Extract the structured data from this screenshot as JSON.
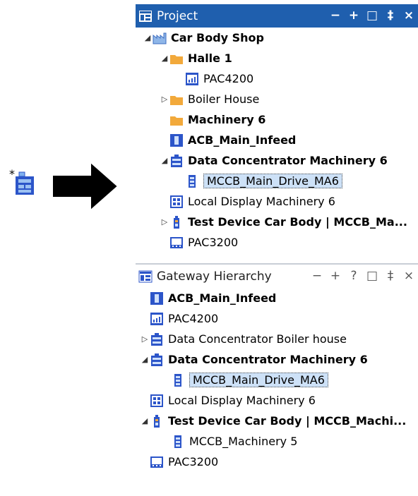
{
  "project": {
    "title": "Project",
    "controls": {
      "minimize": "−",
      "add": "+",
      "maximize": "□",
      "pin": "‡",
      "close": "×"
    },
    "items": [
      {
        "label": "Car Body Shop",
        "expander": "◢",
        "icon": "factory-icon"
      },
      {
        "label": "Halle 1",
        "expander": "◢",
        "icon": "folder-icon"
      },
      {
        "label": "PAC4200",
        "icon": "meter-icon"
      },
      {
        "label": "Boiler House",
        "expander": "▷",
        "icon": "folder-icon"
      },
      {
        "label": "Machinery 6",
        "icon": "folder-icon"
      },
      {
        "label": "ACB_Main_Infeed",
        "icon": "breaker-icon"
      },
      {
        "label": "Data Concentrator Machinery 6",
        "expander": "◢",
        "icon": "concentrator-icon"
      },
      {
        "label": "MCCB_Main_Drive_MA6",
        "icon": "mccb-icon",
        "selected": true
      },
      {
        "label": "Local Display Machinery 6",
        "icon": "display-icon"
      },
      {
        "label": "Test Device Car Body | MCCB_Ma...",
        "expander": "▷",
        "icon": "test-device-icon"
      },
      {
        "label": "PAC3200",
        "icon": "pac3200-icon"
      }
    ]
  },
  "gateway": {
    "title": "Gateway Hierarchy",
    "controls": {
      "minimize": "−",
      "add": "+",
      "help": "?",
      "maximize": "□",
      "pin": "‡",
      "close": "×"
    },
    "items": [
      {
        "label": "ACB_Main_Infeed",
        "icon": "breaker-icon"
      },
      {
        "label": "PAC4200",
        "icon": "meter-icon"
      },
      {
        "label": "Data Concentrator Boiler house",
        "expander": "▷",
        "icon": "concentrator-icon"
      },
      {
        "label": "Data Concentrator Machinery 6",
        "expander": "◢",
        "icon": "concentrator-icon"
      },
      {
        "label": "MCCB_Main_Drive_MA6",
        "icon": "mccb-icon",
        "selected": true
      },
      {
        "label": "Local Display Machinery 6",
        "icon": "display-icon"
      },
      {
        "label": "Test Device Car Body | MCCB_Machi...",
        "expander": "◢",
        "icon": "test-device-icon"
      },
      {
        "label": "MCCB_Machinery 5",
        "icon": "mccb-icon"
      },
      {
        "label": "PAC3200",
        "icon": "pac3200-icon"
      }
    ]
  },
  "colors": {
    "title_bar": "#1f5fae",
    "selection": "#cde1f7",
    "folder": "#f2a93b",
    "device_blue": "#2c55c9"
  }
}
